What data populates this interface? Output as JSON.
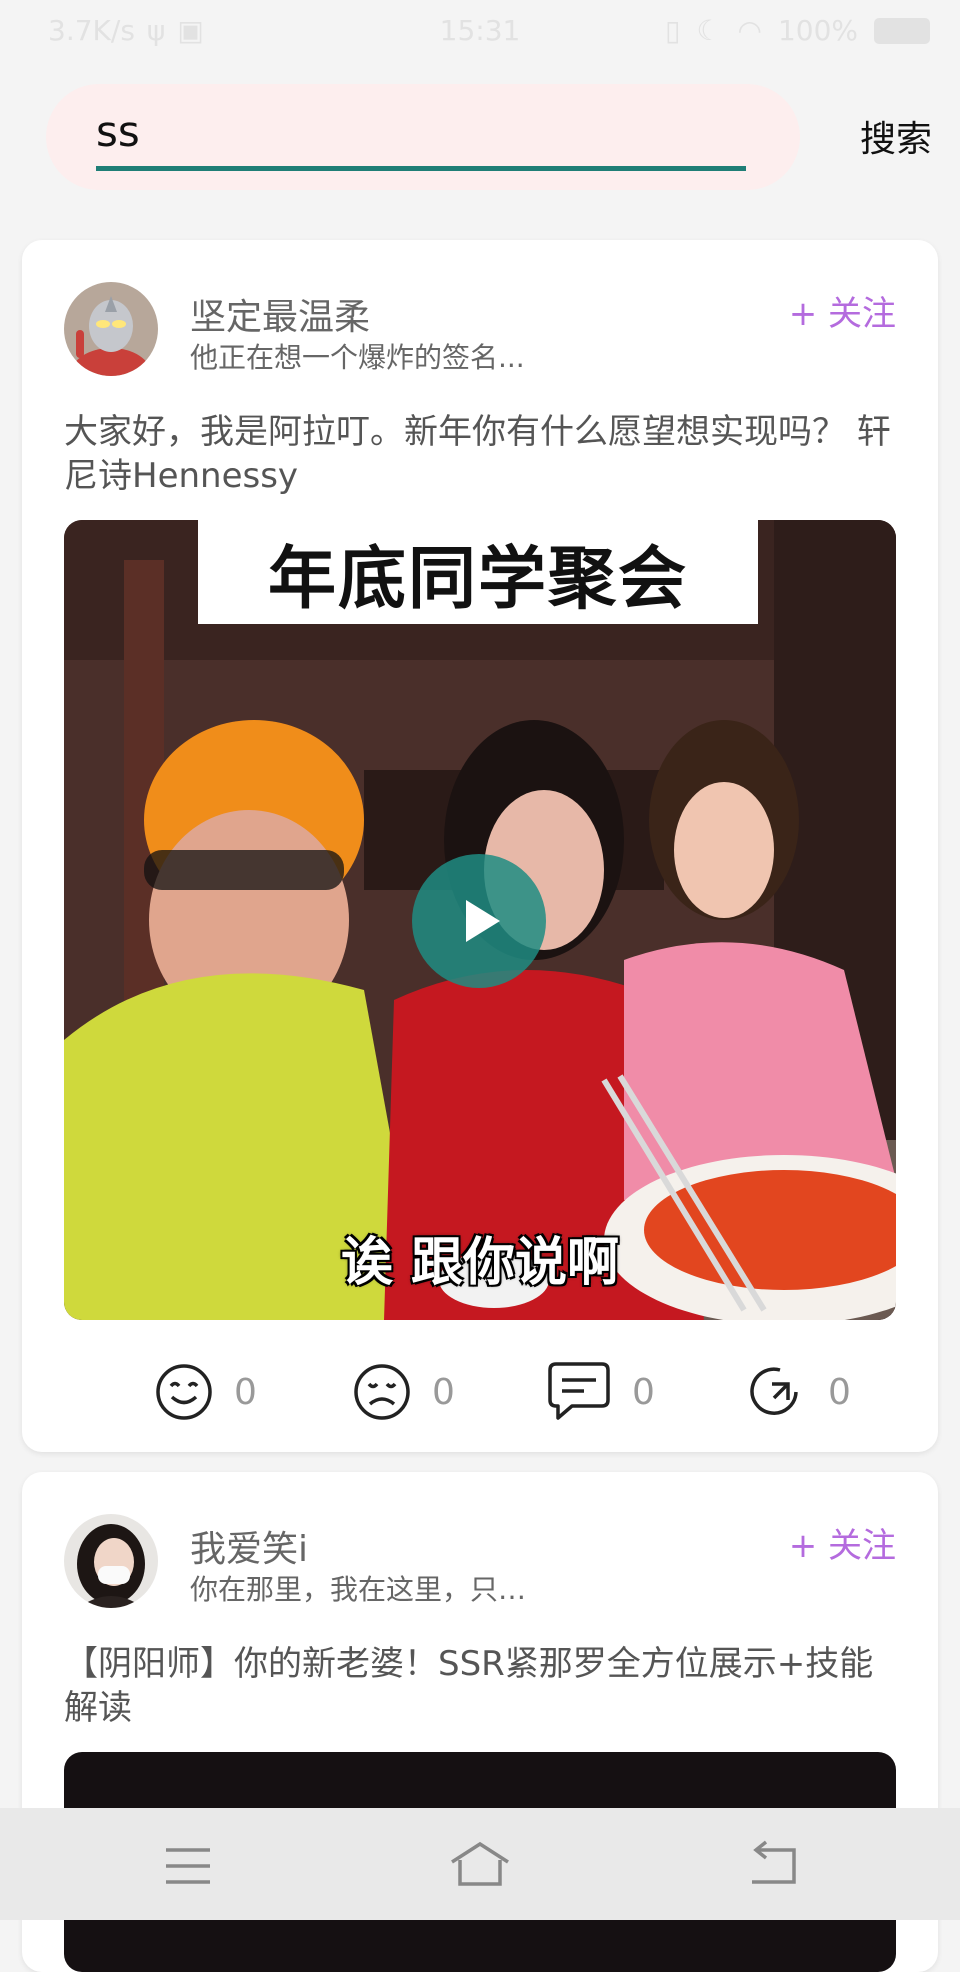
{
  "status_bar": {
    "network_speed": "3.7K/s",
    "time": "15:31",
    "battery": "100%"
  },
  "search": {
    "value": "ss",
    "button_label": "搜索"
  },
  "posts": [
    {
      "username": "坚定最温柔",
      "signature": "他正在想一个爆炸的签名...",
      "follow_label": "+ 关注",
      "text": "大家好，我是阿拉叮。新年你有什么愿望想实现吗？  轩尼诗Hennessy",
      "video_caption_top": "年底同学聚会",
      "video_subtitle": "诶 跟你说啊",
      "actions": {
        "like_count": "0",
        "dislike_count": "0",
        "comment_count": "0",
        "share_count": "0"
      }
    },
    {
      "username": "我爱笑i",
      "signature": "你在那里，我在这里，只…",
      "follow_label": "+ 关注",
      "text": "【阴阳师】你的新老婆！SSR紧那罗全方位展示+技能解读"
    }
  ],
  "colors": {
    "accent_teal": "#1f7e76",
    "follow_purple": "#b46bde",
    "search_bg": "#fdeeee"
  }
}
